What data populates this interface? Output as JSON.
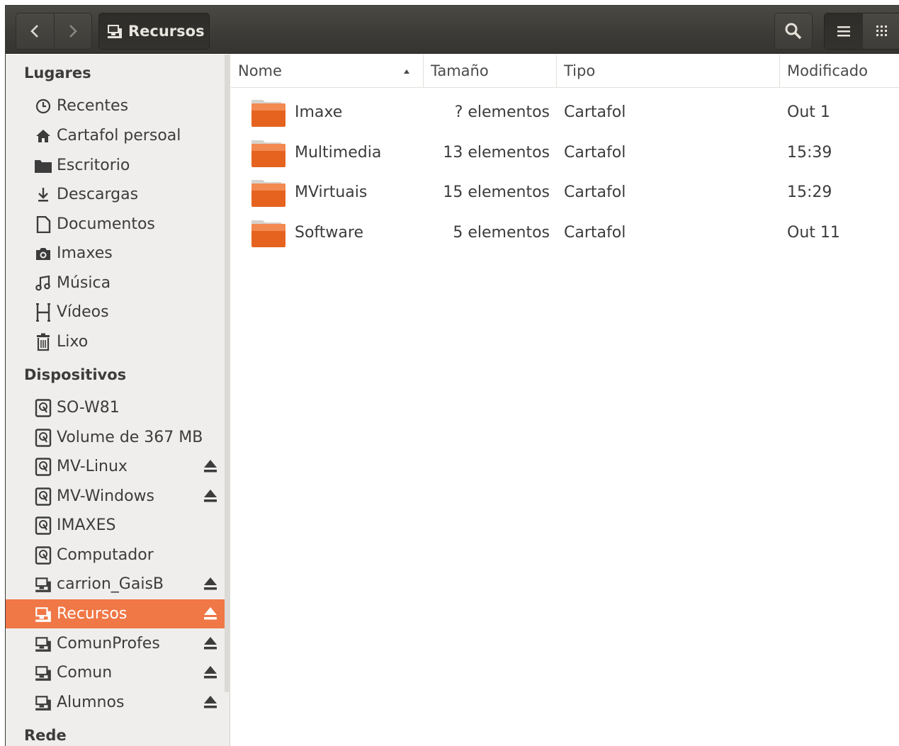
{
  "header": {
    "back_icon": "chevron-left-icon",
    "forward_icon": "chevron-right-icon",
    "path_label": "Recursos",
    "path_icon": "network-share-icon",
    "search_icon": "search-icon",
    "list_view_icon": "list-view-icon",
    "grid_view_icon": "grid-view-icon"
  },
  "sidebar": {
    "places_title": "Lugares",
    "places": [
      {
        "label": "Recentes",
        "icon": "clock-icon"
      },
      {
        "label": "Cartafol persoal",
        "icon": "home-icon"
      },
      {
        "label": "Escritorio",
        "icon": "folder-icon"
      },
      {
        "label": "Descargas",
        "icon": "download-icon"
      },
      {
        "label": "Documentos",
        "icon": "document-icon"
      },
      {
        "label": "Imaxes",
        "icon": "camera-icon"
      },
      {
        "label": "Música",
        "icon": "music-icon"
      },
      {
        "label": "Vídeos",
        "icon": "film-icon"
      },
      {
        "label": "Lixo",
        "icon": "trash-icon"
      }
    ],
    "devices_title": "Dispositivos",
    "devices": [
      {
        "label": "SO-W81",
        "icon": "drive-icon",
        "eject": false
      },
      {
        "label": "Volume de 367 MB",
        "icon": "drive-icon",
        "eject": false
      },
      {
        "label": "MV-Linux",
        "icon": "drive-icon",
        "eject": true
      },
      {
        "label": "MV-Windows",
        "icon": "drive-icon",
        "eject": true
      },
      {
        "label": "IMAXES",
        "icon": "drive-icon",
        "eject": false
      },
      {
        "label": "Computador",
        "icon": "drive-icon",
        "eject": false
      },
      {
        "label": "carrion_GaisB",
        "icon": "network-share-icon",
        "eject": true
      },
      {
        "label": "Recursos",
        "icon": "network-share-icon",
        "eject": true,
        "active": true
      },
      {
        "label": "ComunProfes",
        "icon": "network-share-icon",
        "eject": true
      },
      {
        "label": "Comun",
        "icon": "network-share-icon",
        "eject": true
      },
      {
        "label": "Alumnos",
        "icon": "network-share-icon",
        "eject": true
      }
    ],
    "network_title": "Rede"
  },
  "columns": {
    "name": "Nome",
    "size": "Tamaño",
    "type": "Tipo",
    "modified": "Modificado",
    "sort_icon": "sort-ascending-icon"
  },
  "files": [
    {
      "name": "Imaxe",
      "size": "? elementos",
      "type": "Cartafol",
      "modified": "Out 1"
    },
    {
      "name": "Multimedia",
      "size": "13 elementos",
      "type": "Cartafol",
      "modified": "15:39"
    },
    {
      "name": "MVirtuais",
      "size": "15 elementos",
      "type": "Cartafol",
      "modified": "15:29"
    },
    {
      "name": "Software",
      "size": "5 elementos",
      "type": "Cartafol",
      "modified": "Out 11"
    }
  ],
  "colors": {
    "accent": "#f07746",
    "headerbar": "#3c3b37",
    "folder": "#e5631f"
  }
}
